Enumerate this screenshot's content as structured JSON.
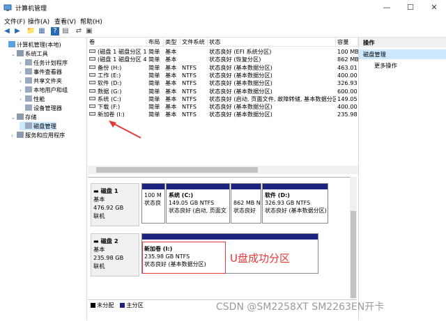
{
  "window": {
    "title": "计算机管理",
    "controls": [
      "—",
      "☐",
      "✕"
    ]
  },
  "menu": [
    "文件(F)",
    "操作(A)",
    "查看(V)",
    "帮助(H)"
  ],
  "toolbar": {
    "icons": [
      "back-icon",
      "forward-icon",
      "up-folder-icon",
      "show-hide-tree-icon",
      "help-icon",
      "properties-icon",
      "export-icon",
      "refresh-icon"
    ],
    "glyphs": [
      "◀",
      "▶",
      "📁",
      "▦",
      "?",
      "▤",
      "⇄",
      "▣"
    ]
  },
  "tree": [
    {
      "label": "计算机管理(本地)",
      "level": 0,
      "exp": ""
    },
    {
      "label": "系统工具",
      "level": 1,
      "exp": "⌄"
    },
    {
      "label": "任务计划程序",
      "level": 2,
      "exp": "›"
    },
    {
      "label": "事件查看器",
      "level": 2,
      "exp": "›"
    },
    {
      "label": "共享文件夹",
      "level": 2,
      "exp": "›"
    },
    {
      "label": "本地用户和组",
      "level": 2,
      "exp": "›"
    },
    {
      "label": "性能",
      "level": 2,
      "exp": "›"
    },
    {
      "label": "设备管理器",
      "level": 2,
      "exp": ""
    },
    {
      "label": "存储",
      "level": 1,
      "exp": "⌄"
    },
    {
      "label": "磁盘管理",
      "level": 2,
      "exp": "",
      "selected": true
    },
    {
      "label": "服务和应用程序",
      "level": 1,
      "exp": "›"
    }
  ],
  "columns": [
    "卷",
    "布局",
    "类型",
    "文件系统",
    "状态",
    "容量"
  ],
  "volumes": [
    {
      "name": "(磁盘 1 磁盘分区 1)",
      "layout": "简单",
      "type": "基本",
      "fs": "",
      "status": "状态良好 (EFI 系统分区)",
      "capacity": "100 MB"
    },
    {
      "name": "(磁盘 1 磁盘分区 4)",
      "layout": "简单",
      "type": "基本",
      "fs": "",
      "status": "状态良好 (恢复分区)",
      "capacity": "862 MB"
    },
    {
      "name": "备份 (H:)",
      "layout": "简单",
      "type": "基本",
      "fs": "NTFS",
      "status": "状态良好 (基本数据分区)",
      "capacity": "463.01"
    },
    {
      "name": "工作 (E:)",
      "layout": "简单",
      "type": "基本",
      "fs": "NTFS",
      "status": "状态良好 (基本数据分区)",
      "capacity": "400.00"
    },
    {
      "name": "软件 (D:)",
      "layout": "简单",
      "type": "基本",
      "fs": "NTFS",
      "status": "状态良好 (基本数据分区)",
      "capacity": "326.93"
    },
    {
      "name": "数据 (G:)",
      "layout": "简单",
      "type": "基本",
      "fs": "NTFS",
      "status": "状态良好 (基本数据分区)",
      "capacity": "600.00"
    },
    {
      "name": "系统 (C:)",
      "layout": "简单",
      "type": "基本",
      "fs": "NTFS",
      "status": "状态良好 (启动, 页面文件, 故障转储, 基本数据分区)",
      "capacity": "149.05"
    },
    {
      "name": "下载 (F:)",
      "layout": "简单",
      "type": "基本",
      "fs": "NTFS",
      "status": "状态良好 (基本数据分区)",
      "capacity": "400.00"
    },
    {
      "name": "新加卷 (I:)",
      "layout": "简单",
      "type": "基本",
      "fs": "NTFS",
      "status": "状态良好 (基本数据分区)",
      "capacity": "235.98"
    }
  ],
  "disks": [
    {
      "name": "磁盘 1",
      "type": "基本",
      "size": "476.92 GB",
      "state": "联机",
      "partitions": [
        {
          "title": "",
          "lines": [
            "100 M",
            "状态良"
          ]
        },
        {
          "title": "系统 (C:)",
          "lines": [
            "149.05 GB NTFS",
            "状态良好 (启动, 页面文"
          ]
        },
        {
          "title": "",
          "lines": [
            "862 MB N",
            "状态良好"
          ]
        },
        {
          "title": "软件 (D:)",
          "lines": [
            "326.93 GB NTFS",
            "状态良好 (基本数据分区)"
          ]
        }
      ]
    },
    {
      "name": "磁盘 2",
      "type": "基本",
      "size": "235.98 GB",
      "state": "联机",
      "partitions": [
        {
          "title": "新加卷 (I:)",
          "lines": [
            "235.98 GB NTFS",
            "状态良好 (基本数据分区)"
          ]
        }
      ]
    }
  ],
  "legend": [
    {
      "label": "未分配",
      "color": "#000000"
    },
    {
      "label": "主分区",
      "color": "#1a237e"
    }
  ],
  "actions": {
    "header": "操作",
    "section": "磁盘管理",
    "more": "更多操作"
  },
  "annotation": {
    "text": "U盘成功分区",
    "color": "#e53935"
  },
  "watermark": "CSDN @SM2258XT SM2263EN开卡"
}
